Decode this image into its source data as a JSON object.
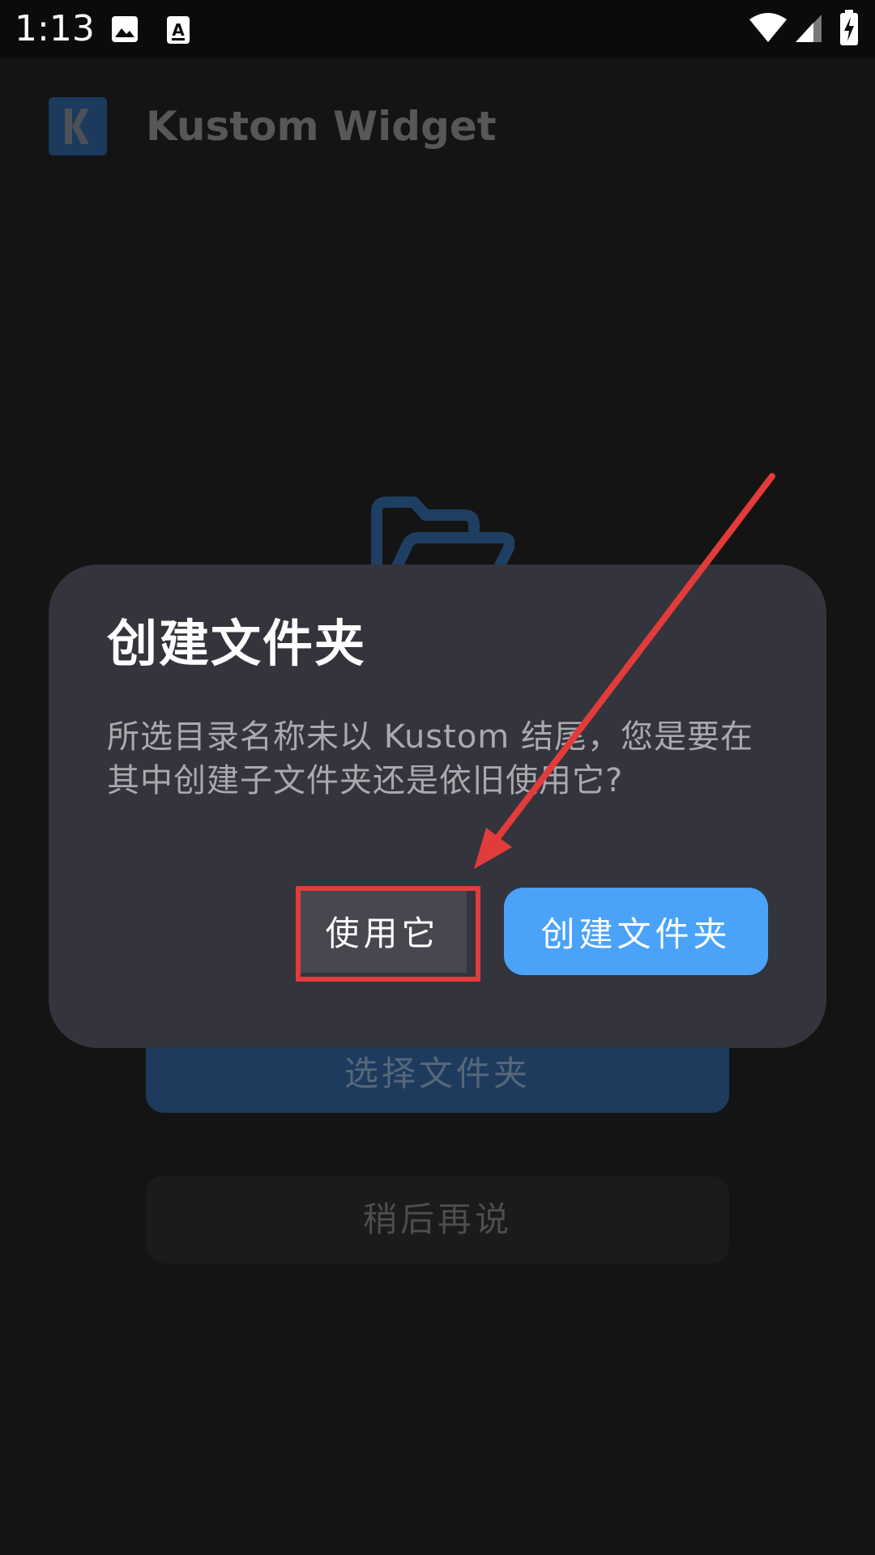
{
  "status_bar": {
    "time": "1:13",
    "icons": [
      "image-icon",
      "keyboard-a-icon",
      "wifi-icon",
      "signal-icon",
      "battery-charging-icon"
    ]
  },
  "app_bar": {
    "logo": "kustom-k-logo",
    "title": "Kustom Widget"
  },
  "background": {
    "folder_icon": "folder-open-icon",
    "select_folder_label": "选择文件夹",
    "later_label": "稍后再说"
  },
  "dialog": {
    "title": "创建文件夹",
    "message_line1": "所选目录名称未以 Kustom 结尾，您是要在",
    "message_line2": "其中创建子文件夹还是依旧使用它?",
    "use_it_label": "使用它",
    "create_folder_label": "创建文件夹"
  },
  "colors": {
    "background": "#141414",
    "dialog": "#33343c",
    "primary_button": "#4aa3f8",
    "annotation": "#e23b3b"
  }
}
